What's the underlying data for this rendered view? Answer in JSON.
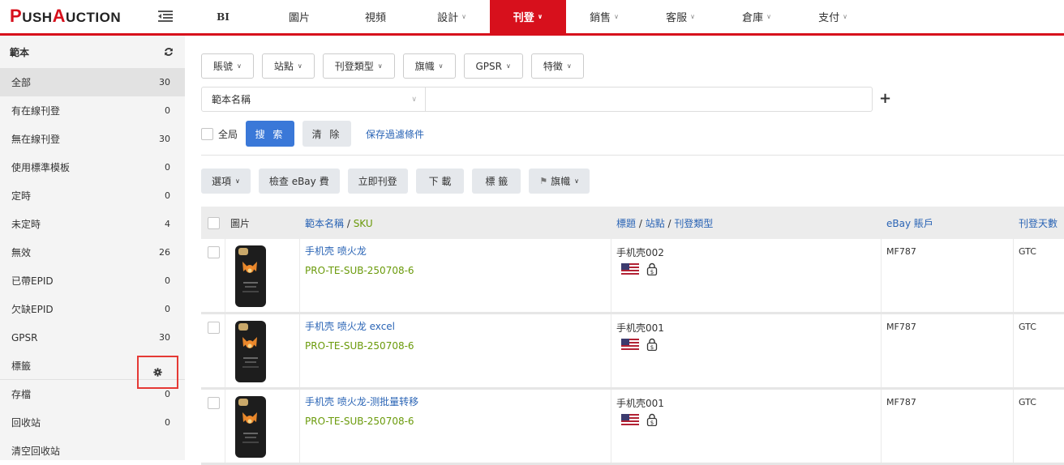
{
  "brand": {
    "p": "P",
    "ush": "USH",
    "a": "A",
    "uction": "UCTION"
  },
  "nav": [
    {
      "label": "BI",
      "chev": ""
    },
    {
      "label": "圖片",
      "chev": ""
    },
    {
      "label": "視頻",
      "chev": ""
    },
    {
      "label": "設計",
      "chev": "∨"
    },
    {
      "label": "刊登",
      "chev": "∨"
    },
    {
      "label": "銷售",
      "chev": "∨"
    },
    {
      "label": "客服",
      "chev": "∨"
    },
    {
      "label": "倉庫",
      "chev": "∨"
    },
    {
      "label": "支付",
      "chev": "∨"
    }
  ],
  "sidebar": {
    "title": "範本",
    "items": [
      {
        "label": "全部",
        "count": "30"
      },
      {
        "label": "有在線刊登",
        "count": "0"
      },
      {
        "label": "無在線刊登",
        "count": "30"
      },
      {
        "label": "使用標準模板",
        "count": "0"
      },
      {
        "label": "定時",
        "count": "0"
      },
      {
        "label": "未定時",
        "count": "4"
      },
      {
        "label": "無效",
        "count": "26"
      },
      {
        "label": "已帶EPID",
        "count": "0"
      },
      {
        "label": "欠缺EPID",
        "count": "0"
      },
      {
        "label": "GPSR",
        "count": "30"
      },
      {
        "label": "標籤",
        "count": ""
      },
      {
        "label": "存檔",
        "count": "0"
      },
      {
        "label": "回收站",
        "count": "0"
      },
      {
        "label": "清空回收站",
        "count": ""
      }
    ]
  },
  "filters": {
    "dropdowns": [
      "賬號",
      "站點",
      "刊登類型",
      "旗幟",
      "GPSR",
      "特徵"
    ],
    "field_select": "範本名稱",
    "all_label": "全局",
    "search": "搜 索",
    "clear": "清 除",
    "save_filter": "保存過濾條件"
  },
  "actions": {
    "options": "選項",
    "check_fee": "檢查 eBay 費",
    "list_now": "立即刊登",
    "download": "下 載",
    "tags": "標 籤",
    "flag": "旗幟"
  },
  "table": {
    "headers": {
      "image": "圖片",
      "name": "範本名稱",
      "sep": " / ",
      "sku": "SKU",
      "title": "標題",
      "site": "站點",
      "type": "刊登類型",
      "account": "eBay 賬戶",
      "days": "刊登天數"
    },
    "rows": [
      {
        "name": "手机壳 喷火龙",
        "sku": "PRO-TE-SUB-250708-6",
        "title": "手机壳002",
        "account": "MF787",
        "days": "GTC"
      },
      {
        "name": "手机壳 喷火龙 excel",
        "sku": "PRO-TE-SUB-250708-6",
        "title": "手机壳001",
        "account": "MF787",
        "days": "GTC"
      },
      {
        "name": "手机壳 喷火龙-测批量转移",
        "sku": "PRO-TE-SUB-250708-6",
        "title": "手机壳001",
        "account": "MF787",
        "days": "GTC"
      }
    ]
  },
  "colors": {
    "brand_red": "#d7101c",
    "link_blue": "#2a64b5",
    "sku_green": "#6a9a0a",
    "primary": "#3a78d8"
  }
}
